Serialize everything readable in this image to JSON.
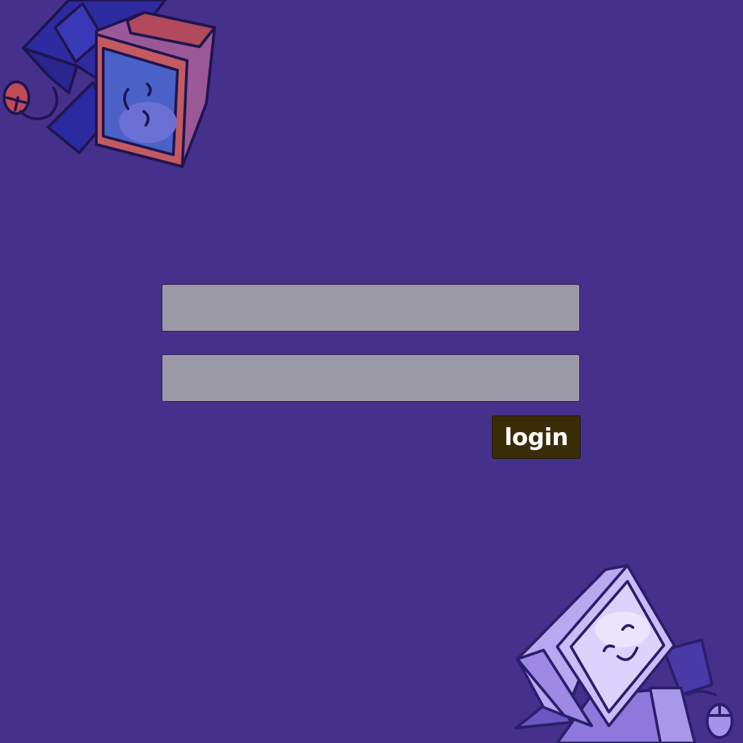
{
  "login": {
    "username_value": "",
    "password_value": "",
    "button_label": "login"
  },
  "colors": {
    "background": "#45308c",
    "field": "#9d9aa8",
    "button": "#3a2c06",
    "button_text": "#ffffff"
  },
  "decorations": {
    "top_left": "computer-mascot-icon",
    "bottom_right": "computer-mascot-icon"
  }
}
